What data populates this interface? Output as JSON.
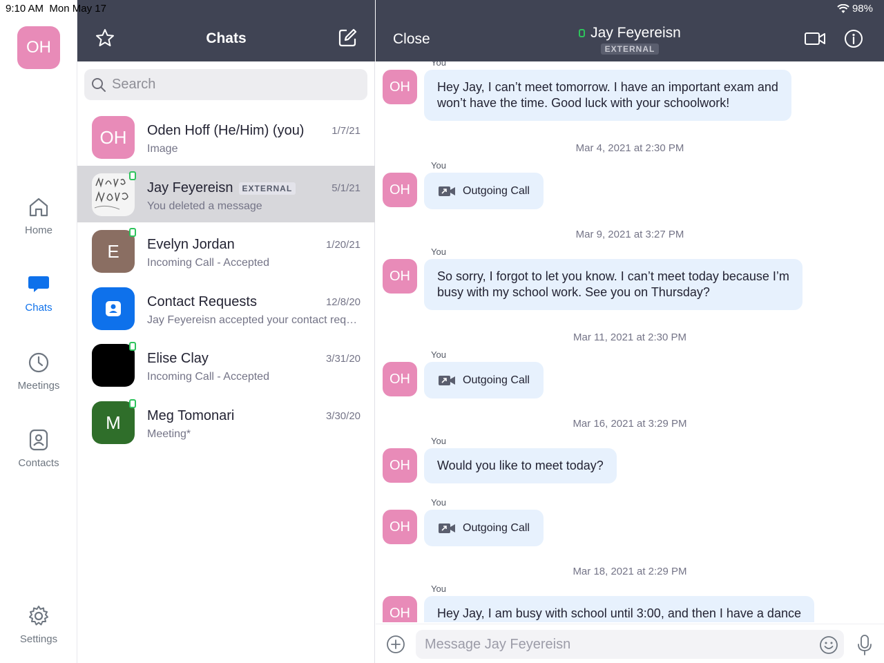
{
  "status_bar": {
    "time": "9:10 AM",
    "date": "Mon May 17",
    "battery": "98%"
  },
  "rail": {
    "user_initials": "OH",
    "items": [
      {
        "label": "Home",
        "icon": "home-icon"
      },
      {
        "label": "Chats",
        "icon": "chat-bubble-icon"
      },
      {
        "label": "Meetings",
        "icon": "clock-icon"
      },
      {
        "label": "Contacts",
        "icon": "contact-card-icon"
      }
    ],
    "settings_label": "Settings"
  },
  "chat_list": {
    "title": "Chats",
    "search_placeholder": "Search",
    "items": [
      {
        "name": "Oden Hoff (He/Him) (you)",
        "preview": "Image",
        "date": "1/7/21",
        "initials": "OH",
        "color": "#e88bb8",
        "external": "",
        "presence": false
      },
      {
        "name": "Jay Feyereisn",
        "preview": "You deleted a message",
        "date": "5/1/21",
        "initials": "",
        "color": "#f4f4f4",
        "external": "EXTERNAL",
        "presence": true
      },
      {
        "name": "Evelyn Jordan",
        "preview": "Incoming Call - Accepted",
        "date": "1/20/21",
        "initials": "E",
        "color": "#8a6e62",
        "external": "",
        "presence": true
      },
      {
        "name": "Contact Requests",
        "preview": "Jay Feyereisn accepted your contact request",
        "date": "12/8/20",
        "initials": "",
        "color": "#0e71eb",
        "external": "",
        "presence": false
      },
      {
        "name": "Elise Clay",
        "preview": "Incoming Call - Accepted",
        "date": "3/31/20",
        "initials": "",
        "color": "#000000",
        "external": "",
        "presence": true
      },
      {
        "name": "Meg Tomonari",
        "preview": "Meeting*",
        "date": "3/30/20",
        "initials": "M",
        "color": "#2f6e2a",
        "external": "",
        "presence": true
      }
    ]
  },
  "conversation": {
    "close_label": "Close",
    "title": "Jay Feyereisn",
    "external_label": "EXTERNAL",
    "sender_label": "You",
    "sender_initials": "OH",
    "messages": [
      {
        "text_lines": [
          "Hey Jay, I can’t meet tomorrow.  I have an important exam and",
          "won’t have the time.  Good luck with your schoolwork!"
        ]
      },
      {
        "date": "Mar 4, 2021 at 2:30 PM",
        "call": "Outgoing Call"
      },
      {
        "date": "Mar 9, 2021 at 3:27 PM",
        "text_lines": [
          "So sorry, I forgot to let you know.  I can’t meet today because I’m",
          "busy with my school work.  See you on Thursday?"
        ]
      },
      {
        "date": "Mar 11, 2021 at 2:30 PM",
        "call": "Outgoing Call"
      },
      {
        "date": "Mar 16, 2021 at 3:29 PM",
        "text": "Would you like to meet today?"
      },
      {
        "call": "Outgoing Call"
      },
      {
        "date": "Mar 18, 2021 at 2:29 PM",
        "text": "Hey Jay, I am busy with school until 3:00, and then I have a dance"
      }
    ],
    "composer_placeholder": "Message Jay Feyereisn"
  }
}
